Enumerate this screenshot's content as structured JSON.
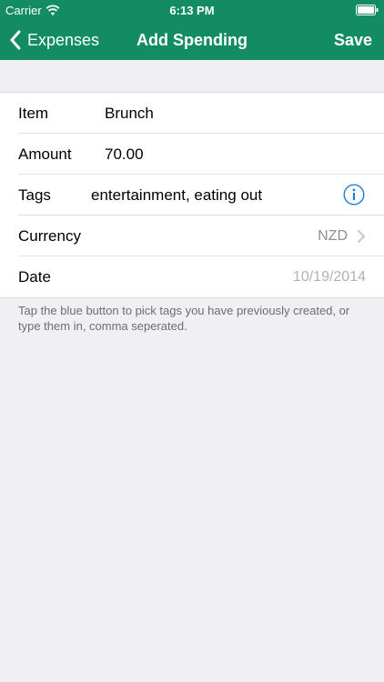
{
  "status_bar": {
    "carrier": "Carrier",
    "time": "6:13 PM"
  },
  "nav": {
    "back_label": "Expenses",
    "title": "Add Spending",
    "save_label": "Save"
  },
  "form": {
    "item": {
      "label": "Item",
      "value": "Brunch"
    },
    "amount": {
      "label": "Amount",
      "value": "70.00"
    },
    "tags": {
      "label": "Tags",
      "value": "entertainment, eating out"
    },
    "currency": {
      "label": "Currency",
      "value": "NZD"
    },
    "date": {
      "label": "Date",
      "value": "10/19/2014"
    }
  },
  "hint": "Tap the blue button to pick tags you have previously created, or type them in, comma seperated.",
  "colors": {
    "accent": "#138c63",
    "info_blue": "#1a7ed8",
    "background": "#efeff4"
  },
  "icons": [
    "wifi-icon",
    "battery-icon",
    "back-chevron-icon",
    "info-icon",
    "chevron-right-icon"
  ]
}
